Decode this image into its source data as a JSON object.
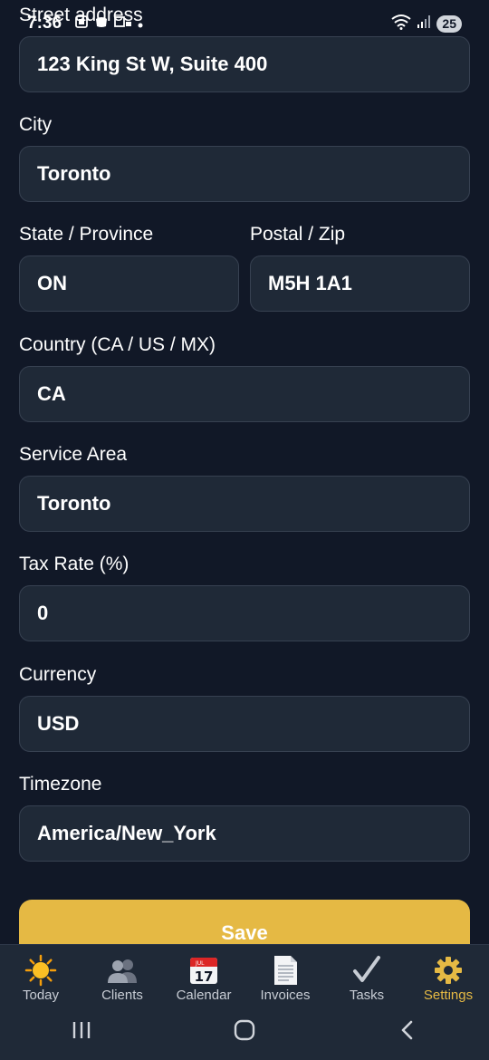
{
  "status_bar": {
    "time": "7:36",
    "battery": "25"
  },
  "form": {
    "street_address": {
      "label": "Street address",
      "value": "123 King St W, Suite 400"
    },
    "city": {
      "label": "City",
      "value": "Toronto"
    },
    "state_province": {
      "label": "State / Province",
      "value": "ON"
    },
    "postal_zip": {
      "label": "Postal / Zip",
      "value": "M5H 1A1"
    },
    "country": {
      "label": "Country (CA / US / MX)",
      "value": "CA"
    },
    "service_area": {
      "label": "Service Area",
      "value": "Toronto"
    },
    "tax_rate": {
      "label": "Tax Rate (%)",
      "value": "0"
    },
    "currency": {
      "label": "Currency",
      "value": "USD"
    },
    "timezone": {
      "label": "Timezone",
      "value": "America/New_York"
    },
    "save_label": "Save"
  },
  "tabs": [
    {
      "label": "Today",
      "icon": "sun-icon"
    },
    {
      "label": "Clients",
      "icon": "people-icon"
    },
    {
      "label": "Calendar",
      "icon": "calendar-icon",
      "calendar_month": "JUL",
      "calendar_day": "17"
    },
    {
      "label": "Invoices",
      "icon": "document-icon"
    },
    {
      "label": "Tasks",
      "icon": "checkmark-icon"
    },
    {
      "label": "Settings",
      "icon": "gear-icon",
      "active": true
    }
  ],
  "colors": {
    "background": "#111827",
    "input_background": "#1f2937",
    "accent": "#e5b944"
  }
}
